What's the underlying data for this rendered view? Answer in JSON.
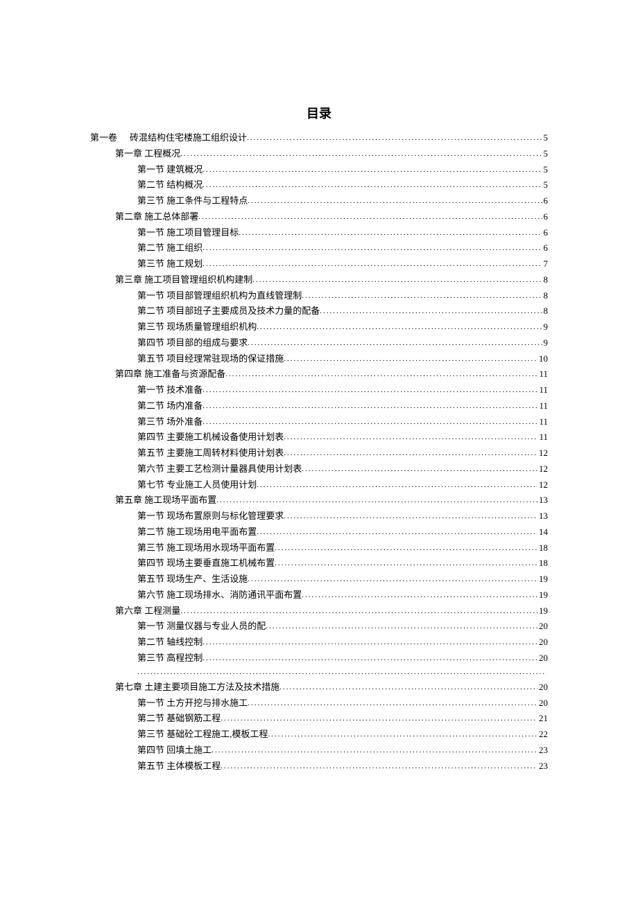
{
  "title": "目录",
  "toc": [
    {
      "level": 0,
      "prefix": "第一卷",
      "label": "砖混结构住宅楼施工组织设计",
      "page": "5"
    },
    {
      "level": 1,
      "prefix": "",
      "label": "第一章 工程概况",
      "page": "5"
    },
    {
      "level": 2,
      "prefix": "",
      "label": "第一节 建筑概况",
      "page": "5"
    },
    {
      "level": 2,
      "prefix": "",
      "label": "第二节 结构概况",
      "page": "5"
    },
    {
      "level": 2,
      "prefix": "",
      "label": "第三节 施工条件与工程特点",
      "page": "6"
    },
    {
      "level": 1,
      "prefix": "",
      "label": "第二章 施工总体部署",
      "page": "6"
    },
    {
      "level": 2,
      "prefix": "",
      "label": "第一节 施工项目管理目标",
      "page": "6"
    },
    {
      "level": 2,
      "prefix": "",
      "label": "第二节 施工组织",
      "page": "6"
    },
    {
      "level": 2,
      "prefix": "",
      "label": "第三节 施工规划",
      "page": "7"
    },
    {
      "level": 1,
      "prefix": "",
      "label": "第三章 施工项目管理组织机构建制",
      "page": "8"
    },
    {
      "level": 2,
      "prefix": "",
      "label": "第一节 项目部管理组织机构为直线管理制",
      "page": "8"
    },
    {
      "level": 2,
      "prefix": "",
      "label": "第二节 项目部班子主要成员及技术力量的配备",
      "page": "8"
    },
    {
      "level": 2,
      "prefix": "",
      "label": "第三节 现场质量管理组织机构",
      "page": "9"
    },
    {
      "level": 2,
      "prefix": "",
      "label": "第四节 项目部的组成与要求",
      "page": "9"
    },
    {
      "level": 2,
      "prefix": "",
      "label": "第五节 项目经理常驻现场的保证措施",
      "page": "10"
    },
    {
      "level": 1,
      "prefix": "",
      "label": "第四章 施工准备与资源配备",
      "page": "11"
    },
    {
      "level": 2,
      "prefix": "",
      "label": "第一节 技术准备",
      "page": "11"
    },
    {
      "level": 2,
      "prefix": "",
      "label": "第二节 场内准备",
      "page": "11"
    },
    {
      "level": 2,
      "prefix": "",
      "label": "第三节 场外准备",
      "page": "11"
    },
    {
      "level": 2,
      "prefix": "",
      "label": "第四节 主要施工机械设备使用计划表",
      "page": "11"
    },
    {
      "level": 2,
      "prefix": "",
      "label": "第五节 主要施工周转材料使用计划表",
      "page": "12"
    },
    {
      "level": 2,
      "prefix": "",
      "label": "第六节 主要工艺检测计量器具使用计划表",
      "page": "12"
    },
    {
      "level": 2,
      "prefix": "",
      "label": "第七节 专业施工人员使用计划",
      "page": "12"
    },
    {
      "level": 1,
      "prefix": "",
      "label": "第五章 施工现场平面布置",
      "page": "13"
    },
    {
      "level": 2,
      "prefix": "",
      "label": "第一节 现场布置原则与标化管理要求",
      "page": "13"
    },
    {
      "level": 2,
      "prefix": "",
      "label": "第二节 施工现场用电平面布置",
      "page": "14"
    },
    {
      "level": 2,
      "prefix": "",
      "label": "第三节 施工现场用水现场平面布置",
      "page": "18"
    },
    {
      "level": 2,
      "prefix": "",
      "label": "第四节 现场主要垂直施工机械布置",
      "page": "18"
    },
    {
      "level": 2,
      "prefix": "",
      "label": "第五节 现场生产、生活设施",
      "page": "19"
    },
    {
      "level": 2,
      "prefix": "",
      "label": "第六节 施工现场排水、消防通讯平面布置",
      "page": "19"
    },
    {
      "level": 1,
      "prefix": "",
      "label": "第六章 工程测量",
      "page": "19"
    },
    {
      "level": 2,
      "prefix": "",
      "label": "第一节 测量仪器与专业人员的配",
      "page": "20"
    },
    {
      "level": 2,
      "prefix": "",
      "label": "第二节 轴线控制",
      "page": "20"
    },
    {
      "level": 2,
      "prefix": "",
      "label": "第三节 高程控制",
      "page": "20"
    },
    {
      "level": 2,
      "prefix": "",
      "label": "",
      "page": ""
    },
    {
      "level": 1,
      "prefix": "",
      "label": "第七章 土建主要项目施工方法及技术措施",
      "page": "20"
    },
    {
      "level": 2,
      "prefix": "",
      "label": "第一节 土方开挖与排水施工",
      "page": "20"
    },
    {
      "level": 2,
      "prefix": "",
      "label": "第二节 基础钢筋工程",
      "page": "21"
    },
    {
      "level": 2,
      "prefix": "",
      "label": "第三节 基础砼工程施工,模板工程",
      "page": "22"
    },
    {
      "level": 2,
      "prefix": "",
      "label": "第四节 回填土施工",
      "page": "23"
    },
    {
      "level": 2,
      "prefix": "",
      "label": "第五节 主体模板工程",
      "page": "23"
    }
  ]
}
